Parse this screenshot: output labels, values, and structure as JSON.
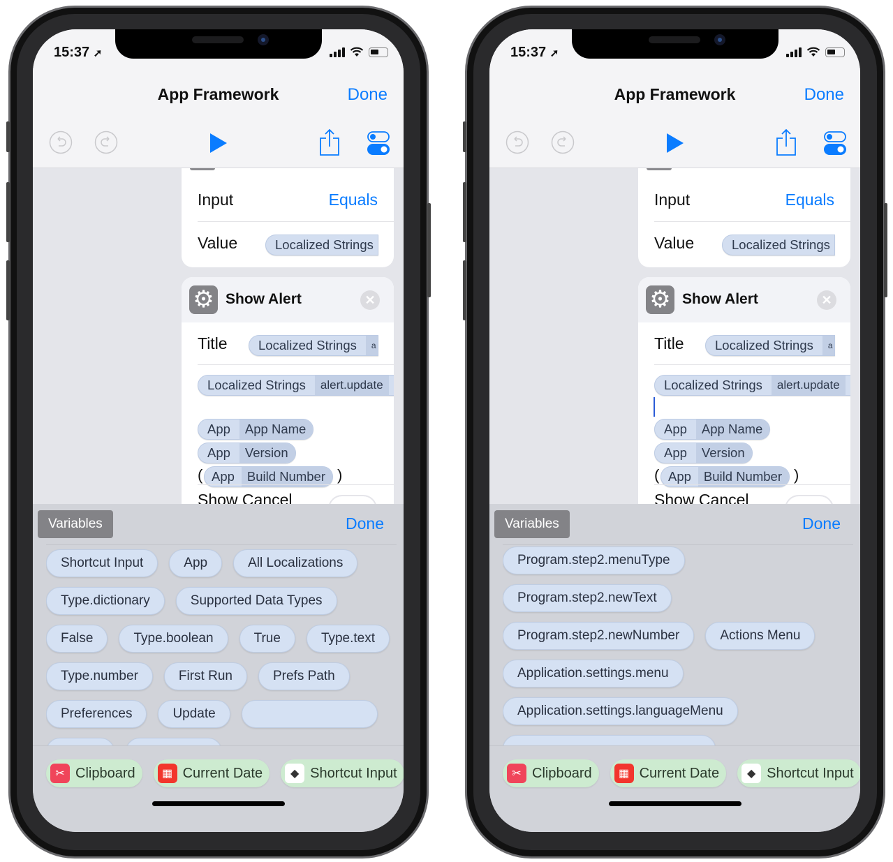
{
  "colors": {
    "accent": "#0a7cff",
    "token": "#d3def0",
    "magic_chip": "#cdebd0",
    "panel": "#d1d3d9"
  },
  "phones": [
    {
      "status": {
        "time": "15:37"
      },
      "nav": {
        "title": "App Framework",
        "done": "Done"
      },
      "toolbar": {
        "icons": [
          "undo-icon",
          "redo-icon",
          "play-icon",
          "share-icon",
          "settings-toggle-icon"
        ]
      },
      "condition_card": {
        "input_label": "Input",
        "input_value": "Equals",
        "value_label": "Value",
        "value_token": "Localized Strings"
      },
      "alert_card": {
        "name": "Show Alert",
        "title_label": "Title",
        "title_token": "Localized Strings",
        "title_token_extra": "a",
        "message_token": "Localized Strings",
        "message_token_key": "alert.update",
        "show_cursor": false,
        "tokens": [
          {
            "source": "App",
            "key": "App Name"
          },
          {
            "source": "App",
            "key": "Version"
          },
          {
            "source": "App",
            "key": "Build Number"
          }
        ],
        "open_paren": "(",
        "close_paren": ")",
        "show_cancel_label": "Show Cancel"
      },
      "variables": {
        "tab": "Variables",
        "done": "Done",
        "items": [
          "Shortcut Input",
          "App",
          "All Localizations",
          "Type.dictionary",
          "Supported Data Types",
          "False",
          "Type.boolean",
          "True",
          "Type.text",
          "Type.number",
          "First Run",
          "Prefs Path",
          "Preferences",
          "Update"
        ]
      },
      "magic": [
        {
          "label": "Clipboard",
          "icon": "scissors-icon"
        },
        {
          "label": "Current Date",
          "icon": "calendar-icon"
        },
        {
          "label": "Shortcut Input",
          "icon": "shortcuts-icon"
        }
      ]
    },
    {
      "status": {
        "time": "15:37"
      },
      "nav": {
        "title": "App Framework",
        "done": "Done"
      },
      "toolbar": {
        "icons": [
          "undo-icon",
          "redo-icon",
          "play-icon",
          "share-icon",
          "settings-toggle-icon"
        ]
      },
      "condition_card": {
        "input_label": "Input",
        "input_value": "Equals",
        "value_label": "Value",
        "value_token": "Localized Strings"
      },
      "alert_card": {
        "name": "Show Alert",
        "title_label": "Title",
        "title_token": "Localized Strings",
        "title_token_extra": "a",
        "message_token": "Localized Strings",
        "message_token_key": "alert.update",
        "show_cursor": true,
        "tokens": [
          {
            "source": "App",
            "key": "App Name"
          },
          {
            "source": "App",
            "key": "Version"
          },
          {
            "source": "App",
            "key": "Build Number"
          }
        ],
        "open_paren": "(",
        "close_paren": ")",
        "show_cancel_label": "Show Cancel"
      },
      "variables": {
        "tab": "Variables",
        "done": "Done",
        "items": [
          "Program.step2.menuType",
          "Program.step2.newText",
          "Program.step2.newNumber",
          "Actions Menu",
          "Application.settings.menu",
          "Application.settings.languageMenu"
        ]
      },
      "magic": [
        {
          "label": "Clipboard",
          "icon": "scissors-icon"
        },
        {
          "label": "Current Date",
          "icon": "calendar-icon"
        },
        {
          "label": "Shortcut Input",
          "icon": "shortcuts-icon"
        }
      ]
    }
  ]
}
